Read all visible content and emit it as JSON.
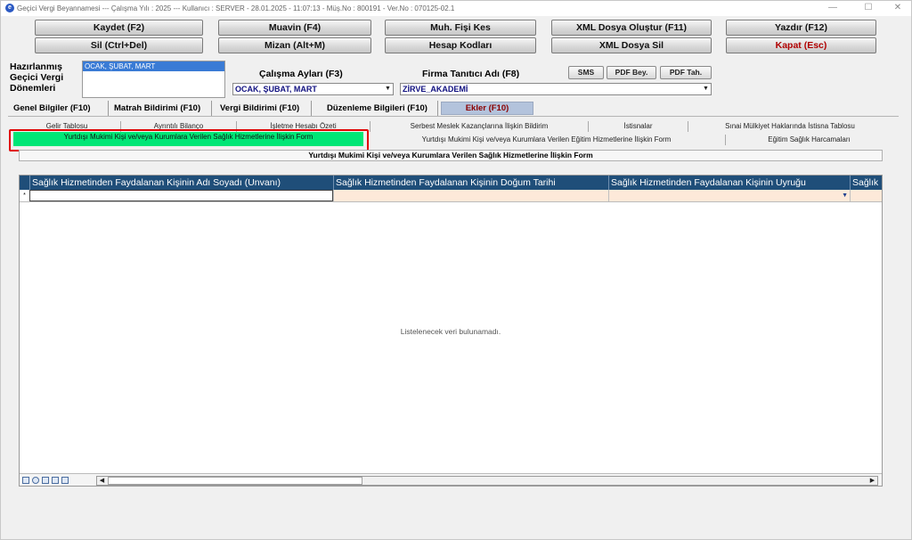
{
  "titlebar": {
    "title": "Geçici Vergi Beyannamesi  ---  Çalışma Yılı : 2025  ---  Kullanıcı : SERVER - 28.01.2025 - 11:07:13 - Müş.No : 800191 - Ver.No : 070125-02.1",
    "minimize": "—",
    "maximize": "☐",
    "close": "✕"
  },
  "toolbar": {
    "kaydet": "Kaydet (F2)",
    "muavin": "Muavin (F4)",
    "fis": "Muh. Fişi Kes",
    "xml_olustur": "XML Dosya Oluştur (F11)",
    "yazdir": "Yazdır (F12)",
    "sil": "Sil (Ctrl+Del)",
    "mizan": "Mizan (Alt+M)",
    "hesap": "Hesap Kodları",
    "xml_sil": "XML Dosya Sil",
    "kapat": "Kapat (Esc)"
  },
  "form": {
    "hazirlanmis_label_1": "Hazırlanmış",
    "hazirlanmis_label_2": "Geçici Vergi",
    "hazirlanmis_label_3": "Dönemleri",
    "donemler": [
      "OCAK, ŞUBAT, MART"
    ],
    "calisma_aylari_label": "Çalışma Ayları (F3)",
    "calisma_aylari_value": "OCAK, ŞUBAT, MART",
    "firma_label": "Firma Tanıtıcı Adı (F8)",
    "firma_value": "ZİRVE_AKADEMİ",
    "sms": "SMS",
    "pdf_bey": "PDF Bey.",
    "pdf_tah": "PDF Tah.",
    "dropdown_arrow": "▼"
  },
  "main_tabs": [
    "Genel Bilgiler (F10)",
    "Matrah Bildirimi (F10)",
    "Vergi Bildirimi (F10)",
    "Düzenleme Bilgileri  (F10)",
    "Ekler (F10)"
  ],
  "sub_tabs_row1": [
    "Gelir Tablosu",
    "Ayrıntılı Bilanço",
    "İşletme Hesabı Özeti",
    "Serbest Meslek Kazançlarına İlişkin Bildirim",
    "İstisnalar",
    "Sınai Mülkiyet Haklarında İstisna Tablosu"
  ],
  "sub_tabs_row2": [
    "Yurtdışı Mukimi Kişi ve/veya Kurumlara Verilen Sağlık Hizmetlerine İlişkin Form",
    "Yurtdışı Mukimi Kişi ve/veya Kurumlara Verilen Eğitim Hizmetlerine İlişkin Form",
    "Eğitim Sağlık Harcamaları"
  ],
  "panel_title": "Yurtdışı Mukimi Kişi ve/veya Kurumlara Verilen Sağlık Hizmetlerine İlişkin Form",
  "grid": {
    "row_marker": "*",
    "columns": [
      "Sağlık Hizmetinden Faydalanan Kişinin Adı Soyadı (Unvanı)",
      "Sağlık Hizmetinden Faydalanan Kişinin Doğum Tarihi",
      "Sağlık Hizmetinden Faydalanan Kişinin Uyruğu",
      "Sağlık H"
    ],
    "empty_text": "Listelenecek veri bulunamadı.",
    "scroll_left": "◀",
    "scroll_right": "▶"
  },
  "colors": {
    "header_bg": "#1f4e79",
    "active_subtab": "#00e676",
    "highlight_frame": "#e00000",
    "new_row_bg": "#fde9d9"
  }
}
